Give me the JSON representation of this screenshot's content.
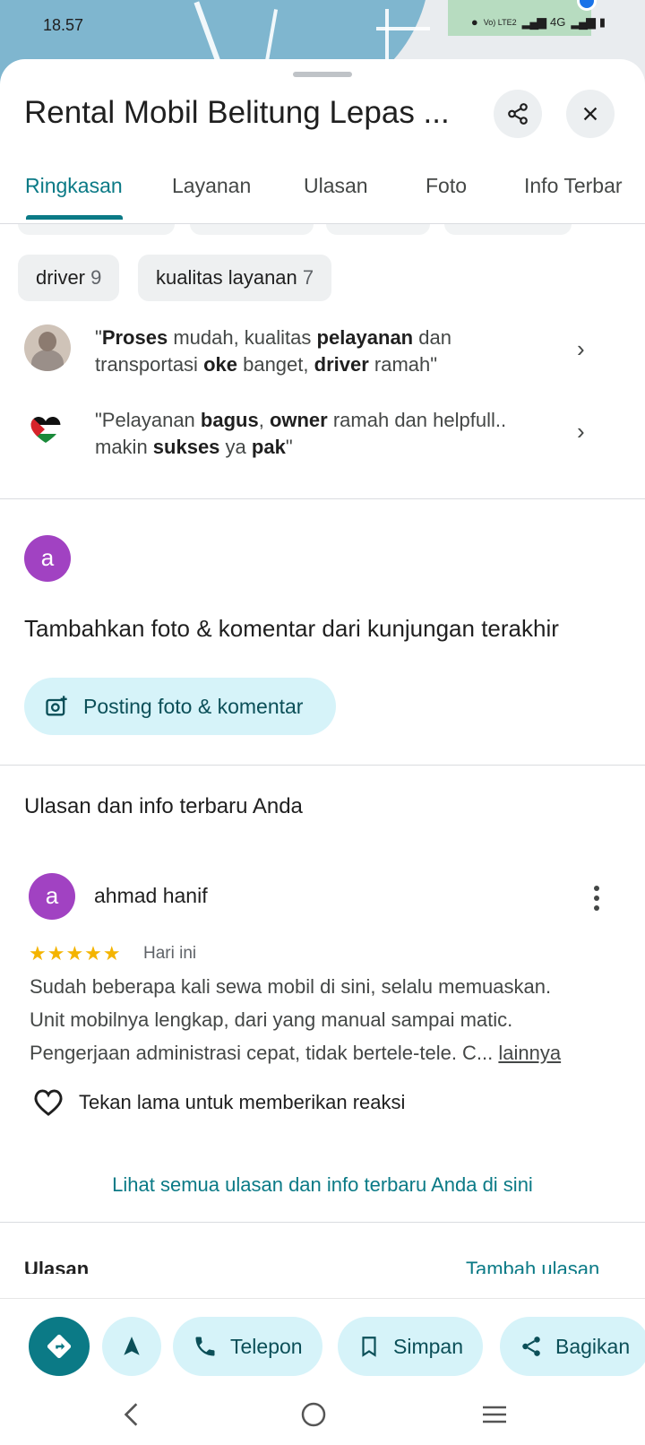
{
  "status": {
    "time": "18.57",
    "network": "4G",
    "volte": "Vo) LTE2"
  },
  "place": {
    "title": "Rental Mobil Belitung Lepas ..."
  },
  "tabs": [
    {
      "label": "Ringkasan",
      "active": true
    },
    {
      "label": "Layanan"
    },
    {
      "label": "Ulasan"
    },
    {
      "label": "Foto"
    },
    {
      "label": "Info Terbar"
    }
  ],
  "chips": [
    {
      "label": "driver",
      "count": "9"
    },
    {
      "label": "kualitas layanan",
      "count": "7"
    }
  ],
  "quotes": [
    {
      "line1_parts": [
        "\"",
        "Proses",
        " mudah, kualitas ",
        "pelayanan",
        " dan"
      ],
      "line2_parts": [
        "transportasi ",
        "oke",
        " banget, ",
        "driver",
        " ramah\""
      ]
    },
    {
      "line1_parts": [
        "\"Pelayanan ",
        "bagus",
        ", ",
        "owner",
        " ramah dan helpfull.."
      ],
      "line2_parts": [
        "makin ",
        "sukses",
        " ya ",
        "pak",
        "\""
      ]
    }
  ],
  "contribute": {
    "avatar_letter": "a",
    "heading": "Tambahkan foto & komentar dari kunjungan terakhir",
    "post_button": "Posting foto & komentar"
  },
  "your_reviews": {
    "heading": "Ulasan dan info terbaru Anda",
    "reviewer_name": "ahmad hanif",
    "reviewer_initial": "a",
    "rating": 5,
    "stars": "★★★★★",
    "date": "Hari ini",
    "line1": "Sudah beberapa kali sewa mobil di sini, selalu memuaskan.",
    "line2": "Unit mobilnya lengkap, dari yang manual sampai matic.",
    "line3": "Pengerjaan administrasi cepat, tidak bertele-tele. C...",
    "more": "lainnya",
    "react_hint": "Tekan lama untuk memberikan reaksi",
    "see_all": "Lihat semua ulasan dan info terbaru Anda di sini"
  },
  "peek": {
    "left": "Ulasan",
    "right": "Tambah ulasan"
  },
  "actions": {
    "call": "Telepon",
    "save": "Simpan",
    "share": "Bagikan"
  },
  "colors": {
    "accent": "#0b7a86",
    "chip_bg": "#d6f3f9",
    "avatar": "#a142c2",
    "star": "#f4b400"
  }
}
